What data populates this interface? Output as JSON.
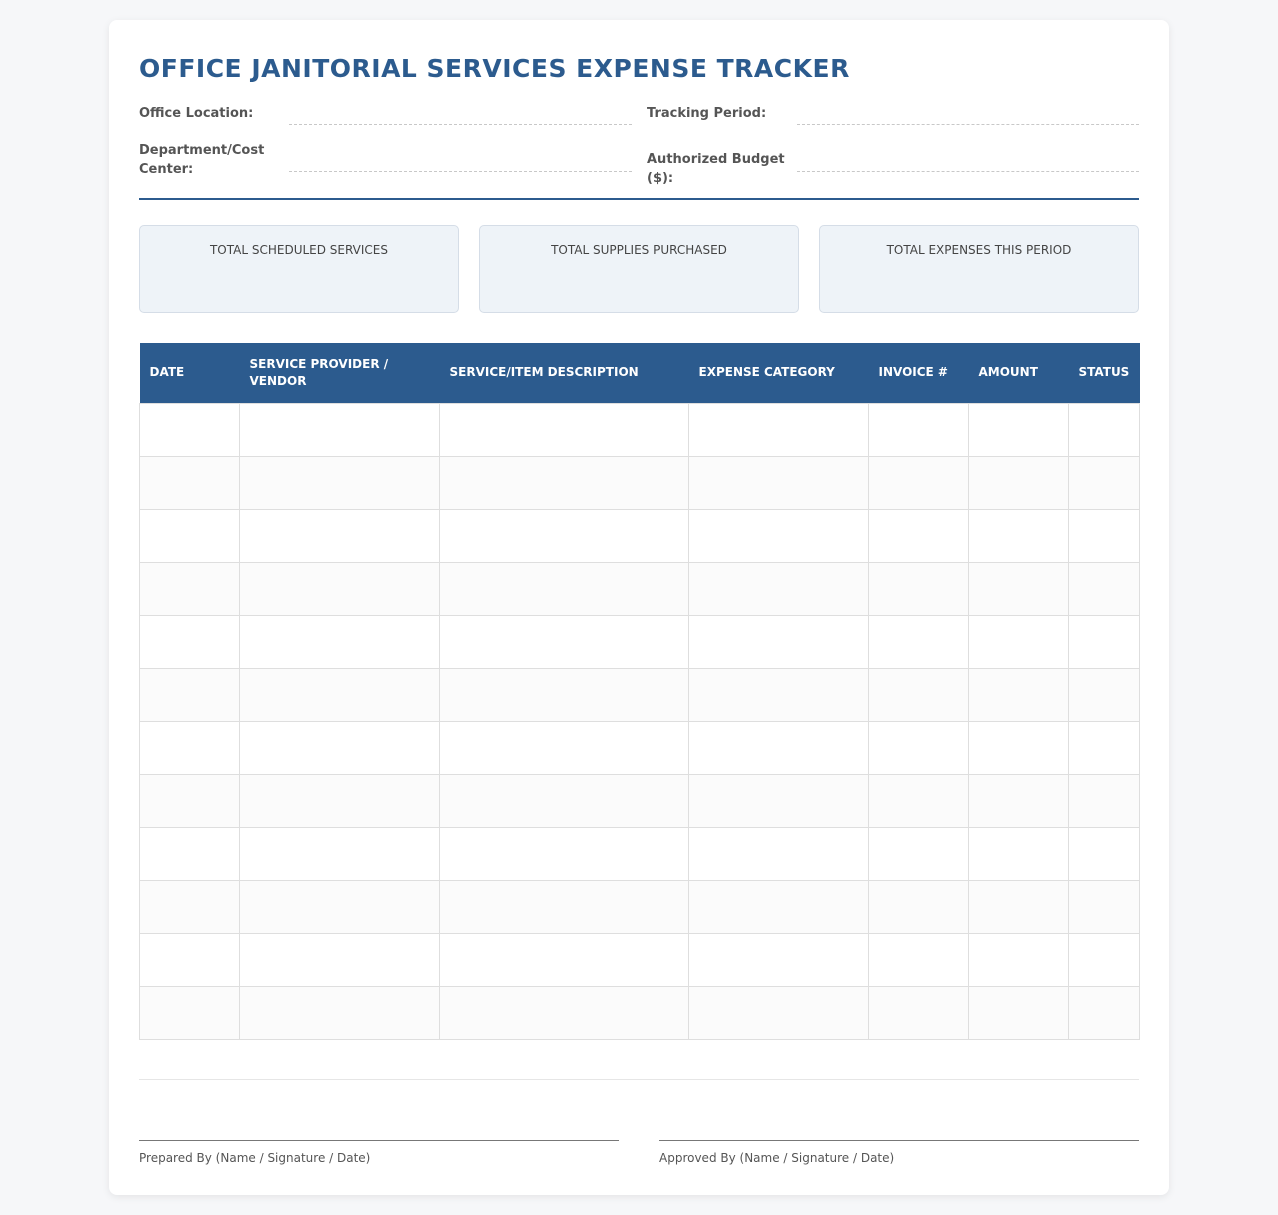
{
  "document": {
    "title": "OFFICE JANITORIAL SERVICES EXPENSE TRACKER"
  },
  "fields": {
    "office_location": "Office Location:",
    "tracking_period": "Tracking Period:",
    "department": "Department/Cost Center:",
    "authorized_budget": "Authorized Budget ($):"
  },
  "summary": [
    {
      "label": "TOTAL SCHEDULED SERVICES"
    },
    {
      "label": "TOTAL SUPPLIES PURCHASED"
    },
    {
      "label": "TOTAL EXPENSES THIS PERIOD"
    }
  ],
  "table": {
    "headers": [
      "DATE",
      "SERVICE PROVIDER / VENDOR",
      "SERVICE/ITEM DESCRIPTION",
      "EXPENSE CATEGORY",
      "INVOICE #",
      "AMOUNT",
      "STATUS"
    ]
  },
  "signatures": {
    "prepared_by": "Prepared By (Name / Signature / Date)",
    "approved_by": "Approved By (Name / Signature / Date)"
  }
}
